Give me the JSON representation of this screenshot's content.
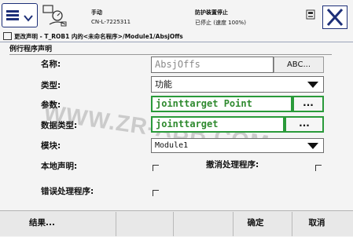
{
  "status": {
    "mode": "手动",
    "controller": "CN-L-7225311",
    "safety": "防护装置停止",
    "state": "已停止 (速度 100%)"
  },
  "breadcrumb": "更改声明 - T_ROB1 内的<未命名程序>/Module1/AbsjOffs",
  "section_title": "例行程序声明",
  "form": {
    "name_label": "名称:",
    "name_value": "AbsjOffs",
    "name_button": "ABC...",
    "type_label": "类型:",
    "type_value": "功能",
    "params_label": "参数:",
    "params_value": "jointtarget Point",
    "params_button": "...",
    "datatype_label": "数据类型:",
    "datatype_value": "jointtarget",
    "datatype_button": "...",
    "module_label": "模块:",
    "module_value": "Module1",
    "local_label": "本地声明:",
    "undo_label": "撤消处理程序:",
    "error_label": "错误处理程序:"
  },
  "watermark": "WWW.ZR-ABB.COM",
  "footer": {
    "result": "结果...",
    "ok": "确定",
    "cancel": "取消"
  },
  "colors": {
    "accent": "#1d2f78",
    "selection_green": "#2a9a3a"
  }
}
